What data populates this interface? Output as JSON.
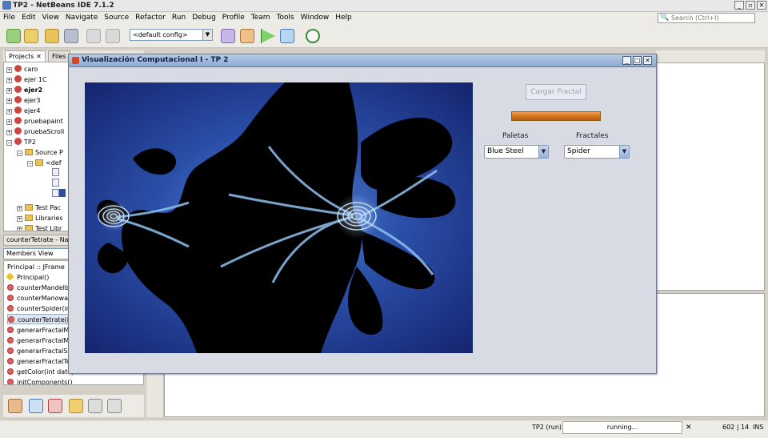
{
  "ide": {
    "title": "TP2 - NetBeans IDE 7.1.2",
    "menu": [
      "File",
      "Edit",
      "View",
      "Navigate",
      "Source",
      "Refactor",
      "Run",
      "Debug",
      "Profile",
      "Team",
      "Tools",
      "Window",
      "Help"
    ],
    "search_placeholder": "Search (Ctrl+I)",
    "config_value": "<default config>"
  },
  "projects_panel": {
    "tabs": [
      "Projects",
      "Files"
    ],
    "tree": [
      "caro",
      "ejer 1C",
      "ejer2",
      "ejer3",
      "ejer4",
      "pruebapaint",
      "pruebaScroll",
      "TP2",
      "Source P",
      "<def",
      "Test Pac",
      "Libraries",
      "Test Libr"
    ]
  },
  "navigator": {
    "title": "counterTetrate - Na",
    "view": "Members View",
    "class": "Principal :: JFrame",
    "members": [
      "Principal()",
      "counterMandelbr",
      "counterManowar",
      "counterSpider(in",
      "counterTetrate(i",
      "generarFractalM",
      "generarFractalM",
      "generarFractalSp",
      "generarFractalTe",
      "getColor(int dato) : Color",
      "initComponents()"
    ]
  },
  "status": {
    "project": "TP2 (run)",
    "progress": "running...",
    "position": "602 | 14",
    "mode": "INS"
  },
  "java_window": {
    "title": "Visualización Computacional I - TP 2",
    "load_button": "Cargar Fractal",
    "progress": 1.0,
    "palettes_label": "Paletas",
    "palette_value": "Blue Steel",
    "fractals_label": "Fractales",
    "fractal_value": "Spider"
  },
  "colors": {
    "accent": "#d0701a",
    "fractal_background": "#15246e",
    "fractal_body": "#000000",
    "fractal_glow": "#5b8fd6"
  }
}
